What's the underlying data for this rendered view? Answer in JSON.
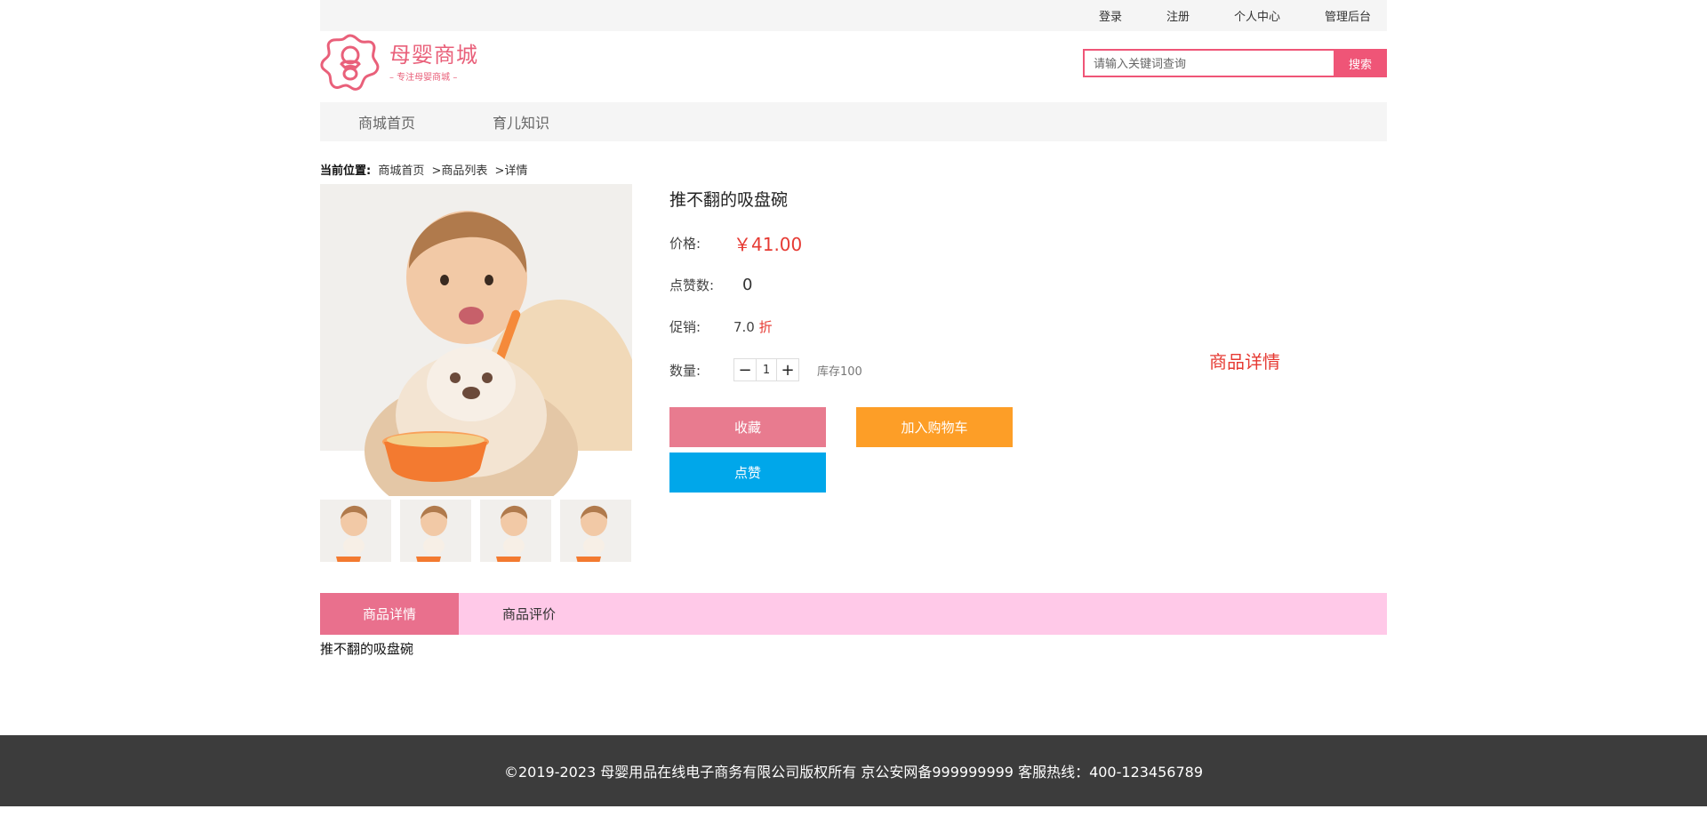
{
  "topbar": {
    "links": [
      "登录",
      "注册",
      "个人中心",
      "管理后台"
    ]
  },
  "header": {
    "logo_title": "母婴商城",
    "logo_sub": "– 专注母婴商城 –",
    "search_placeholder": "请输入关键词查询",
    "search_button": "搜索"
  },
  "nav": {
    "items": [
      "商城首页",
      "育儿知识"
    ]
  },
  "breadcrumb": {
    "label": "当前位置:",
    "items": [
      "商城首页",
      ">商品列表",
      ">详情"
    ]
  },
  "product": {
    "title": "推不翻的吸盘碗",
    "price_label": "价格:",
    "price": "￥41.00",
    "likes_label": "点赞数:",
    "likes": "0",
    "promo_label": "促销:",
    "promo_value": "7.0",
    "promo_unit": "折",
    "qty_label": "数量:",
    "qty_value": "1",
    "stock": "库存100",
    "btn_favorite": "收藏",
    "btn_cart": "加入购物车",
    "btn_like": "点赞",
    "side_detail": "商品详情"
  },
  "tabs": {
    "detail": "商品详情",
    "reviews": "商品评价"
  },
  "detail": {
    "text": "推不翻的吸盘碗"
  },
  "footer": {
    "text": "©2019-2023 母婴用品在线电子商务有限公司版权所有 京公安网备999999999 客服热线：400-123456789"
  },
  "colors": {
    "brand": "#ef5577",
    "price": "#e63a33",
    "fav": "#e87b8f",
    "cart": "#fd9e27",
    "like": "#00a7ea",
    "tabs_bg": "#ffc9e8"
  }
}
